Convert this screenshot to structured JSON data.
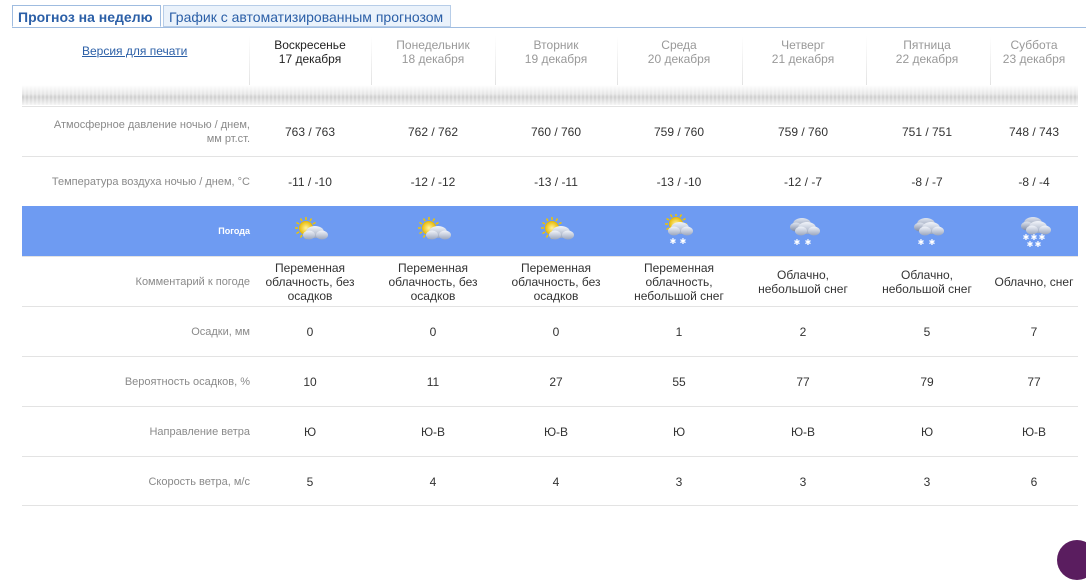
{
  "tabs": [
    {
      "label": "Прогноз на неделю"
    },
    {
      "label": "График с автоматизированным прогнозом"
    }
  ],
  "print_link": "Версия для печати",
  "days": [
    {
      "name": "Воскресенье",
      "date": "17 декабря"
    },
    {
      "name": "Понедельник",
      "date": "18 декабря"
    },
    {
      "name": "Вторник",
      "date": "19 декабря"
    },
    {
      "name": "Среда",
      "date": "20 декабря"
    },
    {
      "name": "Четверг",
      "date": "21 декабря"
    },
    {
      "name": "Пятница",
      "date": "22 декабря"
    },
    {
      "name": "Суббота",
      "date": "23 декабря"
    }
  ],
  "rows": {
    "pressure": {
      "label": [
        "Атмосферное давление ночью  /  днем,",
        "мм рт.ст."
      ],
      "values": [
        "763 / 763",
        "762 / 762",
        "760 / 760",
        "759 / 760",
        "759 / 760",
        "751 / 751",
        "748 / 743"
      ]
    },
    "temperature": {
      "label": [
        "Температура воздуха ночью  /  днем, °С"
      ],
      "values": [
        "-11 / -10",
        "-12 / -12",
        "-13 / -11",
        "-13 / -10",
        "-12 / -7",
        "-8 / -7",
        "-8 / -4"
      ]
    },
    "weather": {
      "label": "Погода",
      "icons": [
        "partly-cloudy-icon",
        "partly-cloudy-icon",
        "partly-cloudy-icon",
        "partly-cloudy-light-snow-icon",
        "cloudy-light-snow-icon",
        "cloudy-light-snow-icon",
        "cloudy-snow-icon"
      ]
    },
    "comment": {
      "label": [
        "Комментарий к погоде"
      ],
      "values": [
        [
          "Переменная",
          "облачность, без",
          "осадков"
        ],
        [
          "Переменная",
          "облачность, без",
          "осадков"
        ],
        [
          "Переменная",
          "облачность, без",
          "осадков"
        ],
        [
          "Переменная",
          "облачность,",
          "небольшой снег"
        ],
        [
          "Облачно,",
          "небольшой снег"
        ],
        [
          "Облачно,",
          "небольшой снег"
        ],
        [
          "Облачно, снег"
        ]
      ]
    },
    "precip": {
      "label": [
        "Осадки, мм"
      ],
      "values": [
        "0",
        "0",
        "0",
        "1",
        "2",
        "5",
        "7"
      ]
    },
    "probability": {
      "label": [
        "Вероятность осадков, %"
      ],
      "values": [
        "10",
        "11",
        "27",
        "55",
        "77",
        "79",
        "77"
      ]
    },
    "wind_dir": {
      "label": [
        "Направление ветра"
      ],
      "values": [
        "Ю",
        "Ю-В",
        "Ю-В",
        "Ю",
        "Ю-В",
        "Ю",
        "Ю-В"
      ]
    },
    "wind_speed": {
      "label": [
        "Скорость ветра, м/с"
      ],
      "values": [
        "5",
        "4",
        "4",
        "3",
        "3",
        "3",
        "6"
      ]
    }
  },
  "colors": {
    "accent": "#2b5fa7",
    "weather_row": "#6e9bf2"
  }
}
